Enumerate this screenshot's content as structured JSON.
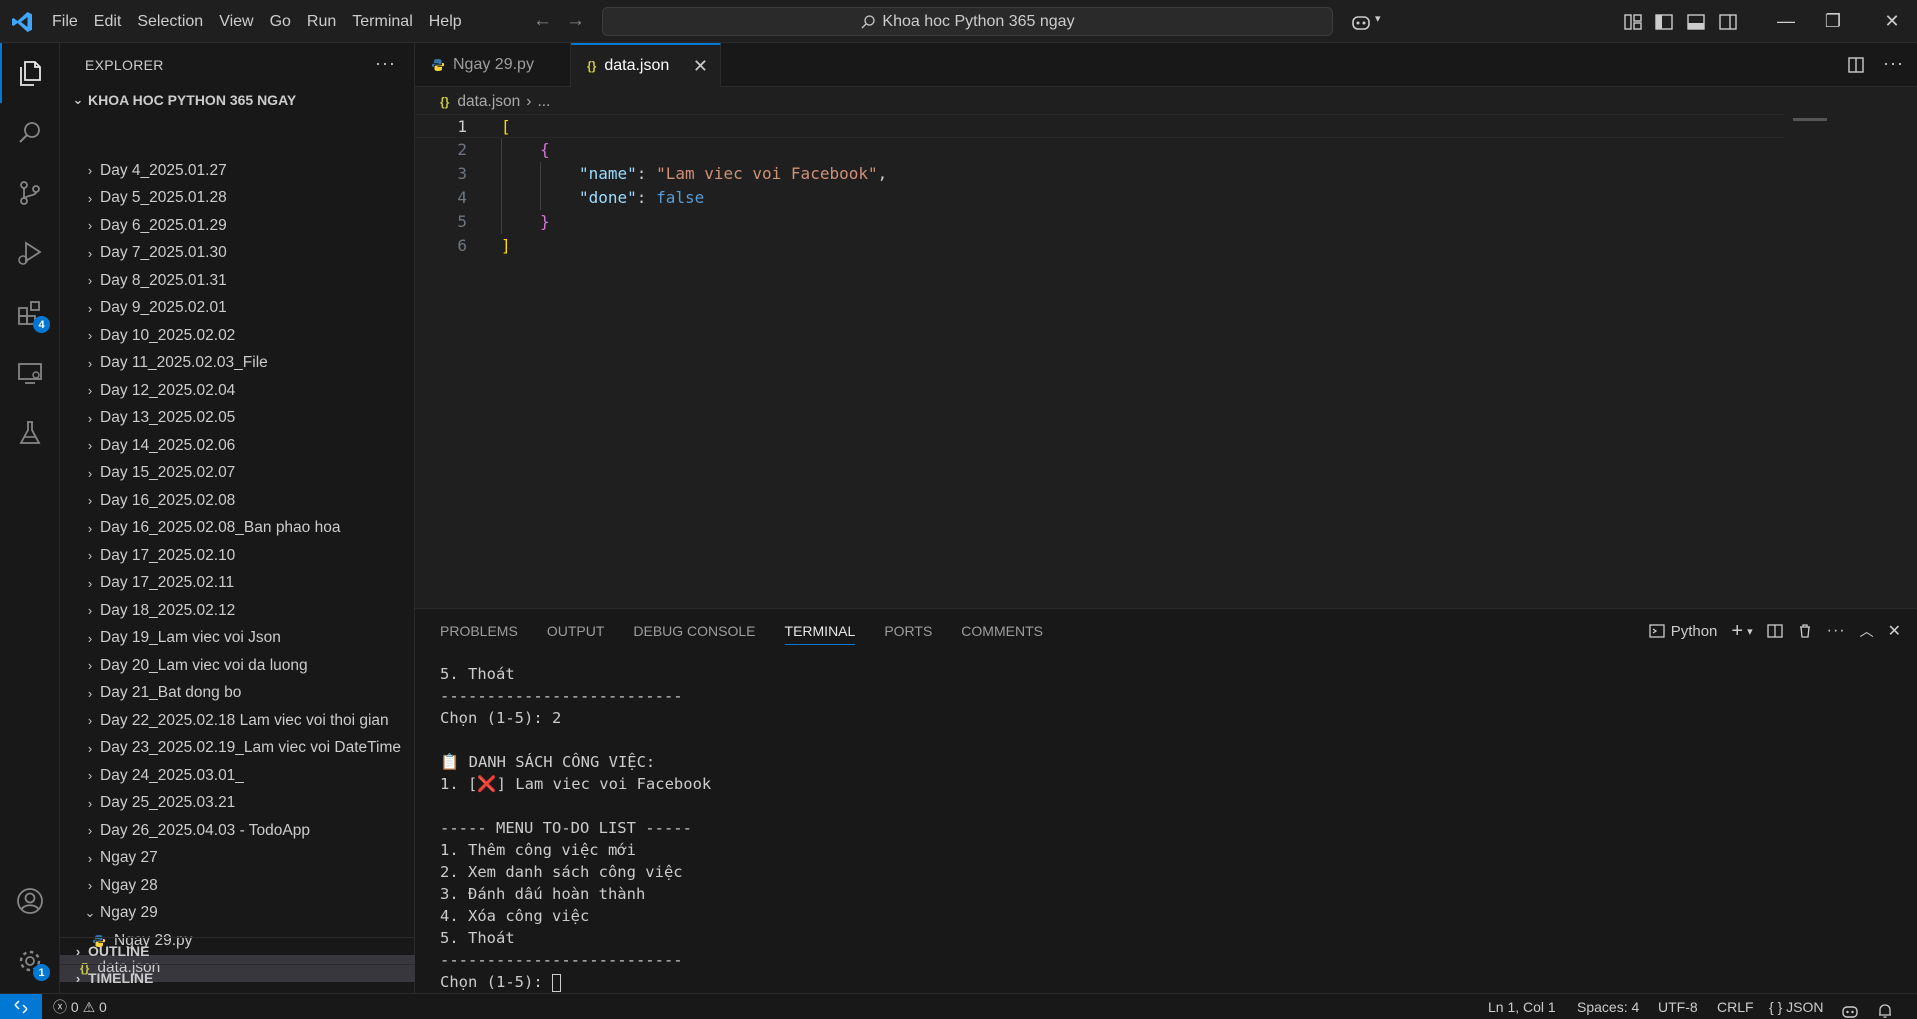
{
  "titlebar": {
    "menu": [
      "File",
      "Edit",
      "Selection",
      "View",
      "Go",
      "Run",
      "Terminal",
      "Help"
    ],
    "search": "Khoa hoc Python 365 ngay"
  },
  "activitybar": {
    "extensions_badge": "4",
    "settings_badge": "1"
  },
  "sidebar": {
    "title": "EXPLORER",
    "project": "KHOA HOC PYTHON 365 NGAY",
    "folders": [
      "Day 4_2025.01.27",
      "Day 5_2025.01.28",
      "Day 6_2025.01.29",
      "Day 7_2025.01.30",
      "Day 8_2025.01.31",
      "Day 9_2025.02.01",
      "Day 10_2025.02.02",
      "Day 11_2025.02.03_File",
      "Day 12_2025.02.04",
      "Day 13_2025.02.05",
      "Day 14_2025.02.06",
      "Day 15_2025.02.07",
      "Day 16_2025.02.08",
      "Day 16_2025.02.08_Ban phao hoa",
      "Day 17_2025.02.10",
      "Day 17_2025.02.11",
      "Day 18_2025.02.12",
      "Day 19_Lam viec voi Json",
      "Day 20_Lam viec voi da luong",
      "Day 21_Bat dong bo",
      "Day 22_2025.02.18 Lam viec voi thoi gian",
      "Day 23_2025.02.19_Lam viec voi DateTime",
      "Day 24_2025.03.01_",
      "Day 25_2025.03.21",
      "Day 26_2025.04.03 - TodoApp",
      "Ngay 27",
      "Ngay 28"
    ],
    "open_folder": "Ngay 29",
    "open_folder_file": "Ngay 29.py",
    "selected_file": "data.json",
    "outline": "OUTLINE",
    "timeline": "TIMELINE"
  },
  "tabs": [
    {
      "label": "Ngay 29.py",
      "icon": "python-icon"
    },
    {
      "label": "data.json",
      "icon": "json-icon"
    }
  ],
  "breadcrumb": {
    "file": "data.json",
    "rest": "..."
  },
  "editor": {
    "line_numbers": [
      "1",
      "2",
      "3",
      "4",
      "5",
      "6"
    ],
    "open_bracket": "[",
    "open_brace": "{",
    "key_name": "\"name\"",
    "value_name": "\"Lam viec voi Facebook\"",
    "key_done": "\"done\"",
    "value_done": "false",
    "close_brace": "}",
    "close_bracket": "]"
  },
  "panel": {
    "tabs": [
      "PROBLEMS",
      "OUTPUT",
      "DEBUG CONSOLE",
      "TERMINAL",
      "PORTS",
      "COMMENTS"
    ],
    "shell": "Python",
    "terminal_lines": [
      "5. Thoát",
      "--------------------------",
      "Chọn (1-5): 2",
      "",
      "📋 DANH SÁCH CÔNG VIỆC:",
      "1. [❌] Lam viec voi Facebook",
      "",
      "----- MENU TO-DO LIST -----",
      "1. Thêm công việc mới",
      "2. Xem danh sách công việc",
      "3. Đánh dấu hoàn thành",
      "4. Xóa công việc",
      "5. Thoát",
      "--------------------------",
      "Chọn (1-5): "
    ]
  },
  "statusbar": {
    "errors": "0",
    "warnings": "0",
    "position": "Ln 1, Col 1",
    "spaces": "Spaces: 4",
    "encoding": "UTF-8",
    "eol": "CRLF",
    "language": "JSON",
    "language_prefix": "{ }"
  }
}
